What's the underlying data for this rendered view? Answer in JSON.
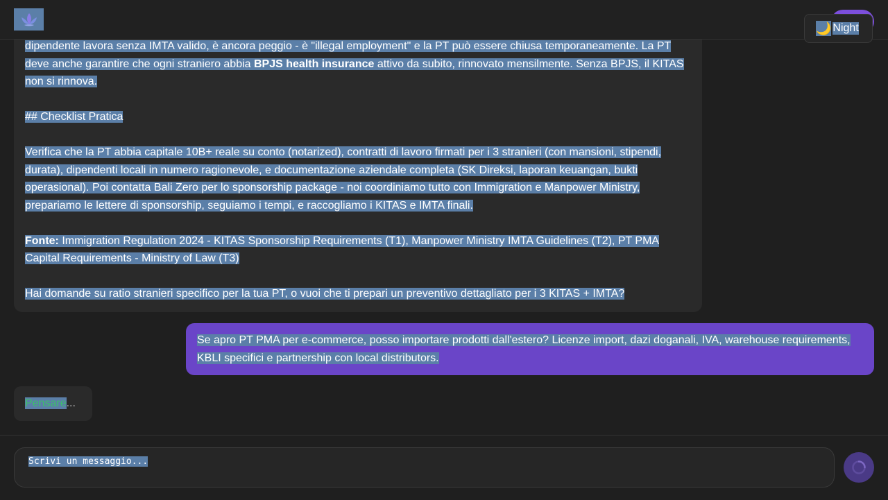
{
  "header": {
    "theme_icon": "🌙",
    "theme_label": "Night"
  },
  "messages": {
    "assistant": {
      "para1_a": "dipendente lavora senza IMTA valido, è ancora peggio - è \"illegal employment\" e la PT può essere chiusa temporaneamente. La PT deve anche garantire che ogni straniero abbia ",
      "para1_bold": "BPJS health insurance",
      "para1_b": " attivo da subito, rinnovato mensilmente. Senza BPJS, il KITAS non si rinnova.",
      "heading": "## Checklist Pratica",
      "para2": "Verifica che la PT abbia capitale 10B+ reale su conto (notarized), contratti di lavoro firmati per i 3 stranieri (con mansioni, stipendi, durata), dipendenti locali in numero ragionevole, e documentazione aziendale completa (SK Direksi, laporan keuangan, bukti operasional). Poi contatta Bali Zero per lo sponsorship package - noi coordiniamo tutto con Immigration e Manpower Ministry, prepariamo le lettere di sponsorship, seguiamo i tempi, e raccogliamo i KITAS e IMTA finali.",
      "source_label": "Fonte:",
      "source_text": " Immigration Regulation 2024 - KITAS Sponsorship Requirements (T1), Manpower Ministry IMTA Guidelines (T2), PT PMA Capital Requirements - Ministry of Law (T3)",
      "question": "Hai domande su ratio stranieri specifico per la tua PT, o vuoi che ti prepari un preventivo dettagliato per i 3 KITAS + IMTA?"
    },
    "user": {
      "text": "Se apro PT PMA per e-commerce, posso importare prodotti dall'estero? Licenze import, dazi doganali, IVA, warehouse requirements, KBLI specifici e partnership con local distributors."
    },
    "typing": {
      "label": "Pensare",
      "dots": "..."
    }
  },
  "composer": {
    "placeholder": "Scrivi un messaggio..."
  },
  "colors": {
    "background": "#1f1f1f",
    "user_bubble": "#6a45c8",
    "selection": "#5b7fa8",
    "typing_label": "#3cbf6a"
  }
}
